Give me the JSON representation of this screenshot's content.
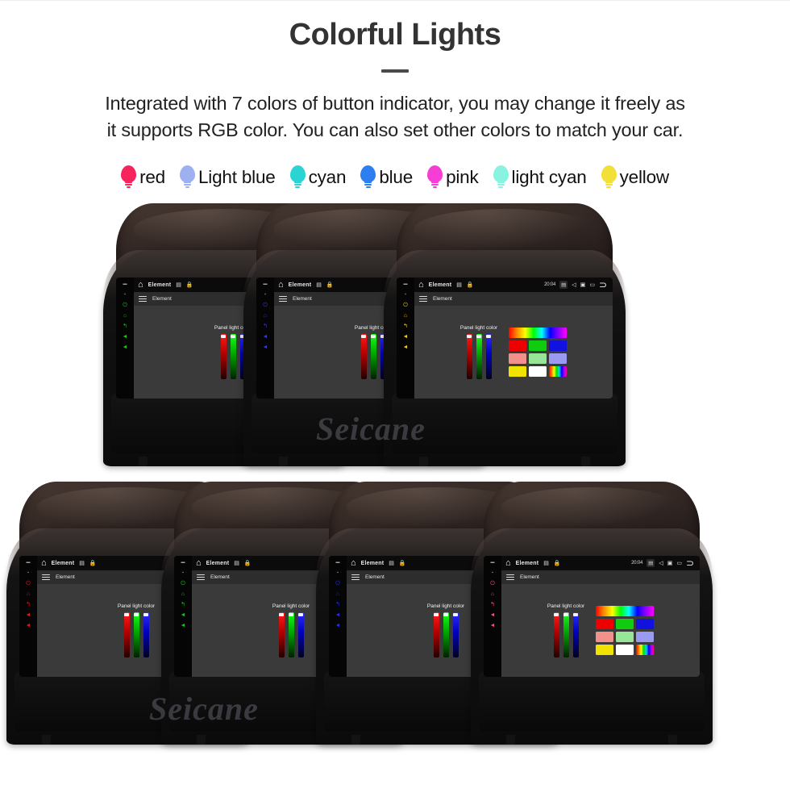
{
  "header": {
    "title": "Colorful Lights",
    "description_line1": "Integrated with 7 colors of button indicator, you may change it freely as",
    "description_line2": "it supports RGB color. You can also set other colors to match your car."
  },
  "legend": {
    "items": [
      {
        "label": "red",
        "color": "#f7245c"
      },
      {
        "label": "Light blue",
        "color": "#9db0ef"
      },
      {
        "label": "cyan",
        "color": "#2ad4d4"
      },
      {
        "label": "blue",
        "color": "#2d7ef0"
      },
      {
        "label": "pink",
        "color": "#f63ed6"
      },
      {
        "label": "light cyan",
        "color": "#88f3e0"
      },
      {
        "label": "yellow",
        "color": "#f2e038"
      }
    ]
  },
  "watermark": {
    "text": "Seicane"
  },
  "screen_ui": {
    "status_bar": {
      "home_icon": "home-icon",
      "title": "Element",
      "save_icon": "save-icon",
      "lock_icon": "lock-icon",
      "time": "20:04",
      "sd_icon": "sd-card-icon",
      "volume_icon": "volume-icon",
      "screenshot_icon": "screenshot-icon",
      "apps_icon": "recent-apps-icon",
      "back_icon": "back-icon"
    },
    "app_bar": {
      "menu_icon": "hamburger-menu-icon",
      "title": "Element"
    },
    "panel": {
      "label": "Panel light color",
      "sliders": [
        {
          "name": "red",
          "value": 92
        },
        {
          "name": "green",
          "value": 92
        },
        {
          "name": "blue",
          "value": 92
        }
      ],
      "palette": [
        {
          "name": "rainbow-gradient",
          "color": "rainbow",
          "wide": true
        },
        {
          "name": "red",
          "color": "#ee0000"
        },
        {
          "name": "green",
          "color": "#10cc10"
        },
        {
          "name": "blue",
          "color": "#1212e0"
        },
        {
          "name": "light-red",
          "color": "#f2918c"
        },
        {
          "name": "light-green",
          "color": "#97e697"
        },
        {
          "name": "light-blue",
          "color": "#9a9af0"
        },
        {
          "name": "yellow",
          "color": "#f2e200"
        },
        {
          "name": "white",
          "color": "#ffffff"
        },
        {
          "name": "rainbow-stripes",
          "color": "rainbow-v"
        }
      ]
    },
    "side_keys": [
      {
        "name": "mic-key",
        "glyph": "▬"
      },
      {
        "name": "eject-key",
        "glyph": "▪"
      },
      {
        "name": "power-key",
        "glyph": "⏻"
      },
      {
        "name": "home-key",
        "glyph": "⌂"
      },
      {
        "name": "back-key",
        "glyph": "↰"
      },
      {
        "name": "vol-down-key",
        "glyph": "◄"
      },
      {
        "name": "vol-up-key",
        "glyph": "◄"
      }
    ]
  },
  "rows": [
    {
      "name": "top-row",
      "units": [
        {
          "name": "unit-green",
          "key_color": "#19c219",
          "show_status_right": false,
          "show_palette": false
        },
        {
          "name": "unit-blue",
          "key_color": "#3a37d8",
          "show_status_right": false,
          "show_palette": false
        },
        {
          "name": "unit-yellow",
          "key_color": "#e8c81d",
          "show_status_right": true,
          "show_palette": true
        }
      ]
    },
    {
      "name": "bottom-row",
      "units": [
        {
          "name": "unit-red",
          "key_color": "#e01818",
          "show_status_right": false,
          "show_palette": false
        },
        {
          "name": "unit-green",
          "key_color": "#19c219",
          "show_status_right": false,
          "show_palette": false
        },
        {
          "name": "unit-blue",
          "key_color": "#2a2af0",
          "show_status_right": false,
          "show_palette": false
        },
        {
          "name": "unit-pink",
          "key_color": "#f04f8f",
          "show_status_right": true,
          "show_palette": true
        }
      ]
    }
  ]
}
